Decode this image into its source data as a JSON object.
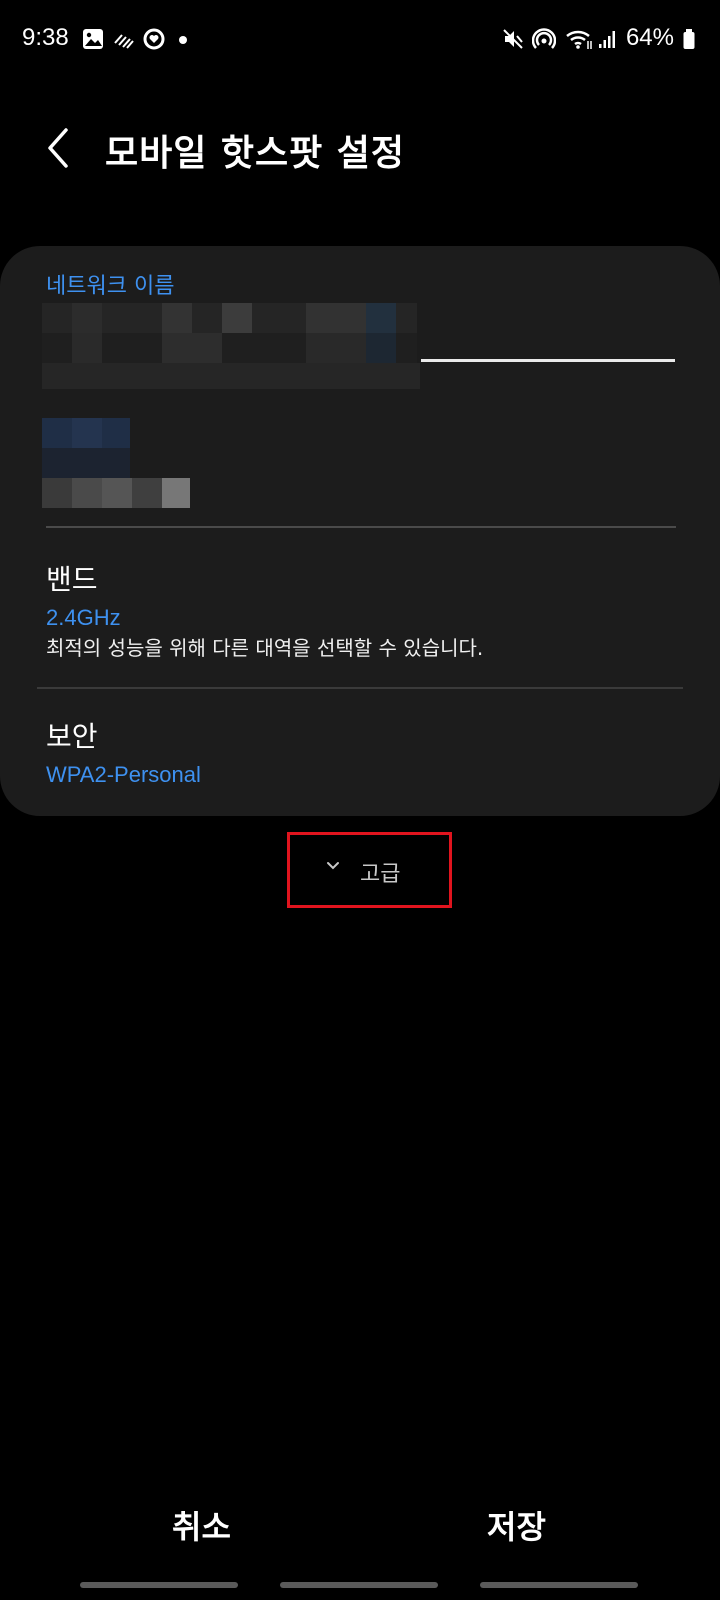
{
  "status_bar": {
    "time": "9:38",
    "battery": "64%",
    "icons": [
      "gallery-icon",
      "signal-lines-icon",
      "heart-circle-icon",
      "dot-icon",
      "mute-icon",
      "hotspot-icon",
      "wifi-icon",
      "cell-signal-icon",
      "battery-icon"
    ]
  },
  "header": {
    "title": "모바일 핫스팟 설정",
    "back_icon": "chevron-left-icon"
  },
  "network": {
    "label": "네트워크 이름"
  },
  "band": {
    "title": "밴드",
    "value": "2.4GHz",
    "description": "최적의 성능을 위해 다른 대역을 선택할 수 있습니다."
  },
  "security": {
    "title": "보안",
    "value": "WPA2-Personal"
  },
  "advanced": {
    "label": "고급",
    "icon": "chevron-down-icon",
    "highlight_color": "#e0141e"
  },
  "actions": {
    "cancel": "취소",
    "save": "저장"
  },
  "colors": {
    "accent": "#3e91f0",
    "card_background": "#1c1c1c"
  }
}
